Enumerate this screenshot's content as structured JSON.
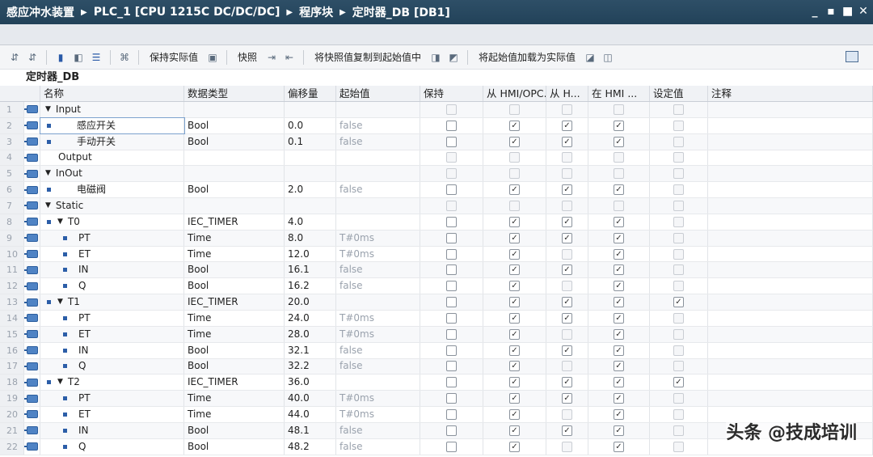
{
  "title": {
    "crumbs": [
      "感应冲水装置",
      "PLC_1 [CPU 1215C DC/DC/DC]",
      "程序块",
      "定时器_DB [DB1]"
    ],
    "window_buttons": [
      "_",
      "▪",
      "■",
      "✕"
    ]
  },
  "toolbar": {
    "keep_actual": "保持实际值",
    "snapshot": "快照",
    "copy_snapshot": "将快照值复制到起始值中",
    "load_start": "将起始值加载为实际值"
  },
  "block_title": "定时器_DB",
  "columns": {
    "name": "名称",
    "type": "数据类型",
    "offset": "偏移量",
    "start": "起始值",
    "keep": "保持",
    "hmi1": "从 HMI/OPC...",
    "hmi2": "从 H...",
    "hmi3": "在 HMI ...",
    "setval": "设定值",
    "note": "注释"
  },
  "rows": [
    {
      "num": "1",
      "level": 0,
      "expand": "▼",
      "name": "Input",
      "type": "",
      "offset": "",
      "start": "",
      "keep": "dim",
      "hmi1": "dim",
      "hmi2": "dim",
      "hmi3": "dim",
      "set": "dim"
    },
    {
      "num": "2",
      "level": 1,
      "bullet": true,
      "name": "感应开关",
      "type": "Bool",
      "offset": "0.0",
      "start": "false",
      "keep": "empty",
      "hmi1": "check",
      "hmi2": "check",
      "hmi3": "check",
      "set": "dim",
      "selected": true
    },
    {
      "num": "3",
      "level": 1,
      "bullet": true,
      "name": "手动开关",
      "type": "Bool",
      "offset": "0.1",
      "start": "false",
      "keep": "empty",
      "hmi1": "check",
      "hmi2": "check",
      "hmi3": "check",
      "set": "dim"
    },
    {
      "num": "4",
      "level": 0,
      "expand": "",
      "name": "Output",
      "type": "",
      "offset": "",
      "start": "",
      "keep": "dim",
      "hmi1": "dim",
      "hmi2": "dim",
      "hmi3": "dim",
      "set": "dim"
    },
    {
      "num": "5",
      "level": 0,
      "expand": "▼",
      "name": "InOut",
      "type": "",
      "offset": "",
      "start": "",
      "keep": "dim",
      "hmi1": "dim",
      "hmi2": "dim",
      "hmi3": "dim",
      "set": "dim"
    },
    {
      "num": "6",
      "level": 1,
      "bullet": true,
      "name": "电磁阀",
      "type": "Bool",
      "offset": "2.0",
      "start": "false",
      "keep": "empty",
      "hmi1": "check",
      "hmi2": "check",
      "hmi3": "check",
      "set": "dim"
    },
    {
      "num": "7",
      "level": 0,
      "expand": "▼",
      "name": "Static",
      "type": "",
      "offset": "",
      "start": "",
      "keep": "dim",
      "hmi1": "dim",
      "hmi2": "dim",
      "hmi3": "dim",
      "set": "dim"
    },
    {
      "num": "8",
      "level": 1,
      "bullet": true,
      "expand": "▼",
      "name": "T0",
      "type": "IEC_TIMER",
      "offset": "4.0",
      "start": "",
      "keep": "empty",
      "hmi1": "check",
      "hmi2": "check",
      "hmi3": "check",
      "set": "dim"
    },
    {
      "num": "9",
      "level": 2,
      "bullet": true,
      "name": "PT",
      "type": "Time",
      "offset": "8.0",
      "start": "T#0ms",
      "keep": "empty",
      "hmi1": "check",
      "hmi2": "check",
      "hmi3": "check",
      "set": "dim"
    },
    {
      "num": "10",
      "level": 2,
      "bullet": true,
      "name": "ET",
      "type": "Time",
      "offset": "12.0",
      "start": "T#0ms",
      "keep": "empty",
      "hmi1": "check",
      "hmi2": "dim",
      "hmi3": "check",
      "set": "dim"
    },
    {
      "num": "11",
      "level": 2,
      "bullet": true,
      "name": "IN",
      "type": "Bool",
      "offset": "16.1",
      "start": "false",
      "keep": "empty",
      "hmi1": "check",
      "hmi2": "check",
      "hmi3": "check",
      "set": "dim"
    },
    {
      "num": "12",
      "level": 2,
      "bullet": true,
      "name": "Q",
      "type": "Bool",
      "offset": "16.2",
      "start": "false",
      "keep": "empty",
      "hmi1": "check",
      "hmi2": "dim",
      "hmi3": "check",
      "set": "dim"
    },
    {
      "num": "13",
      "level": 1,
      "bullet": true,
      "expand": "▼",
      "name": "T1",
      "type": "IEC_TIMER",
      "offset": "20.0",
      "start": "",
      "keep": "empty",
      "hmi1": "check",
      "hmi2": "check",
      "hmi3": "check",
      "set": "check"
    },
    {
      "num": "14",
      "level": 2,
      "bullet": true,
      "name": "PT",
      "type": "Time",
      "offset": "24.0",
      "start": "T#0ms",
      "keep": "empty",
      "hmi1": "check",
      "hmi2": "check",
      "hmi3": "check",
      "set": "dim"
    },
    {
      "num": "15",
      "level": 2,
      "bullet": true,
      "name": "ET",
      "type": "Time",
      "offset": "28.0",
      "start": "T#0ms",
      "keep": "empty",
      "hmi1": "check",
      "hmi2": "dim",
      "hmi3": "check",
      "set": "dim"
    },
    {
      "num": "16",
      "level": 2,
      "bullet": true,
      "name": "IN",
      "type": "Bool",
      "offset": "32.1",
      "start": "false",
      "keep": "empty",
      "hmi1": "check",
      "hmi2": "check",
      "hmi3": "check",
      "set": "dim"
    },
    {
      "num": "17",
      "level": 2,
      "bullet": true,
      "name": "Q",
      "type": "Bool",
      "offset": "32.2",
      "start": "false",
      "keep": "empty",
      "hmi1": "check",
      "hmi2": "dim",
      "hmi3": "check",
      "set": "dim"
    },
    {
      "num": "18",
      "level": 1,
      "bullet": true,
      "expand": "▼",
      "name": "T2",
      "type": "IEC_TIMER",
      "offset": "36.0",
      "start": "",
      "keep": "empty",
      "hmi1": "check",
      "hmi2": "check",
      "hmi3": "check",
      "set": "check"
    },
    {
      "num": "19",
      "level": 2,
      "bullet": true,
      "name": "PT",
      "type": "Time",
      "offset": "40.0",
      "start": "T#0ms",
      "keep": "empty",
      "hmi1": "check",
      "hmi2": "check",
      "hmi3": "check",
      "set": "dim"
    },
    {
      "num": "20",
      "level": 2,
      "bullet": true,
      "name": "ET",
      "type": "Time",
      "offset": "44.0",
      "start": "T#0ms",
      "keep": "empty",
      "hmi1": "check",
      "hmi2": "dim",
      "hmi3": "check",
      "set": "dim"
    },
    {
      "num": "21",
      "level": 2,
      "bullet": true,
      "name": "IN",
      "type": "Bool",
      "offset": "48.1",
      "start": "false",
      "keep": "empty",
      "hmi1": "check",
      "hmi2": "check",
      "hmi3": "check",
      "set": "dim"
    },
    {
      "num": "22",
      "level": 2,
      "bullet": true,
      "name": "Q",
      "type": "Bool",
      "offset": "48.2",
      "start": "false",
      "keep": "empty",
      "hmi1": "check",
      "hmi2": "dim",
      "hmi3": "check",
      "set": "dim"
    }
  ],
  "watermark": "头条 @技成培训",
  "colors": {
    "titlebar": "#2e4f67",
    "toolbar": "#f4f5f7",
    "accent": "#2c5ea8"
  }
}
